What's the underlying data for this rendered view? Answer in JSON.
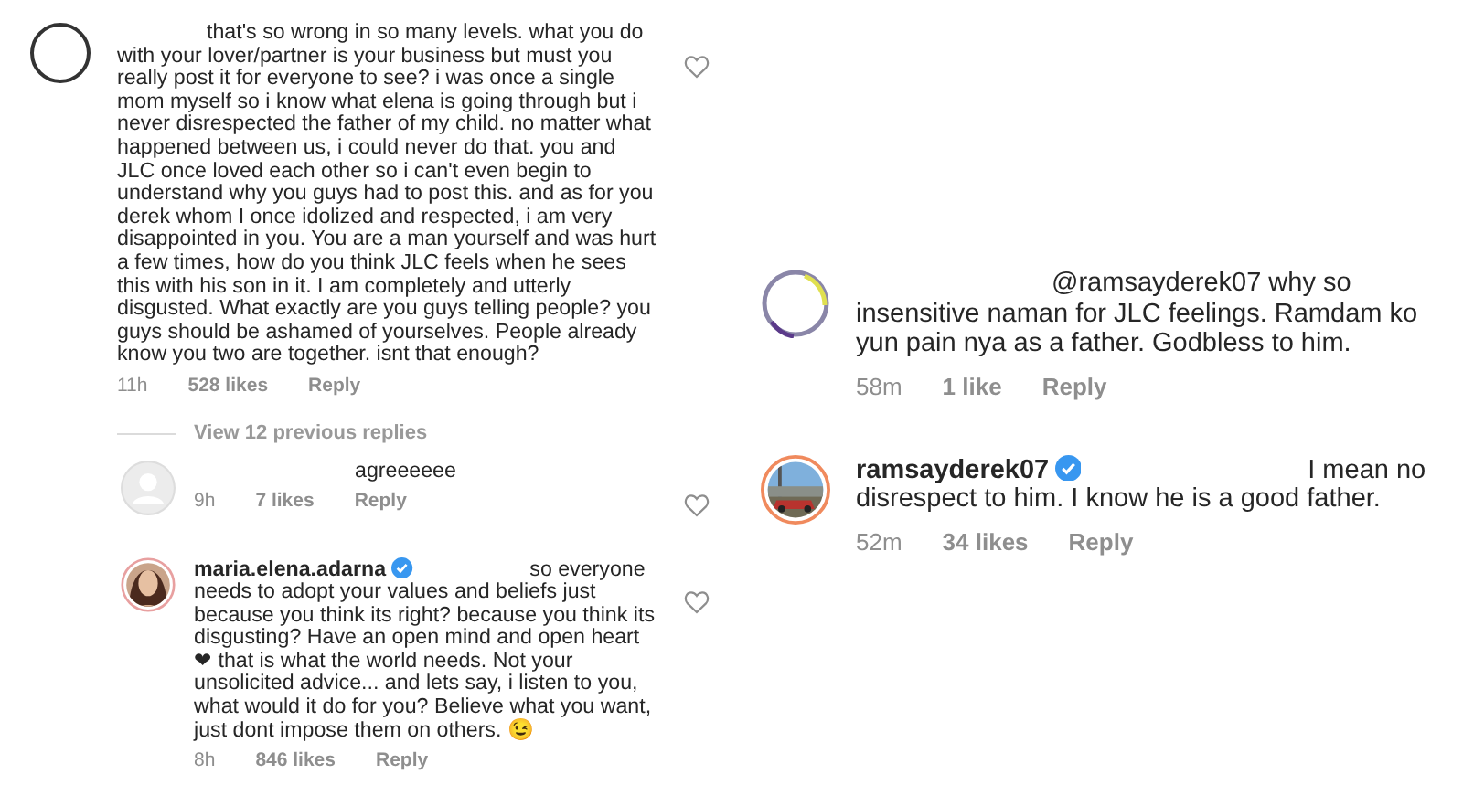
{
  "panels": [
    {
      "items": [
        {
          "kind": "comment",
          "avatar": {
            "kind": "outline"
          },
          "text": "that's so wrong in so many levels. what you do with your lover/partner is your business but must you really post it for everyone to see? i was once a single mom myself so i know what elena is going through but i never disrespected the father of my child. no matter what happened between us, i could never do that. you and JLC once loved each other so i can't even begin to understand why you guys had to post this. and as for you derek whom I once idolized and respected, i am very disappointed in you. You are a man yourself and was hurt a few times, how do you think JLC feels when he sees this with his son in it. I am completely and utterly disgusted. What exactly are you guys telling people? you guys should be ashamed of yourselves. People already know you two are together. isnt that enough?",
          "time": "11h",
          "likes": "528 likes",
          "reply": "Reply",
          "like_button": true
        },
        {
          "kind": "view_replies",
          "text": "View 12 previous replies"
        },
        {
          "kind": "comment",
          "avatar": {
            "kind": "default"
          },
          "text": "agreeeeee",
          "time": "9h",
          "likes": "7 likes",
          "reply": "Reply",
          "like_button": true
        },
        {
          "kind": "comment",
          "username": "maria.elena.adarna",
          "verified": true,
          "text": "so everyone needs to adopt your values and beliefs just because you think its right?  because you think its disgusting? Have an open mind and open heart ❤ that is what the world needs. Not your unsolicited advice... and lets say, i listen to you, what would it do for you? Believe what you want, just dont impose them on others. 😉",
          "time": "8h",
          "likes": "846 likes",
          "reply": "Reply",
          "like_button": true
        }
      ]
    },
    {
      "items": [
        {
          "kind": "comment",
          "avatar": {
            "kind": "colored-ring"
          },
          "text": "@ramsayderek07 why so insensitive naman for JLC feelings. Ramdam ko yun pain nya as a father. Godbless to him.",
          "time": "58m",
          "likes": "1 like",
          "reply": "Reply",
          "like_button": false
        },
        {
          "kind": "comment",
          "username": "ramsayderek07",
          "verified": true,
          "text": "I mean no disrespect to him. I know he is a good father.",
          "time": "52m",
          "likes": "34 likes",
          "reply": "Reply",
          "like_button": false
        }
      ]
    }
  ]
}
